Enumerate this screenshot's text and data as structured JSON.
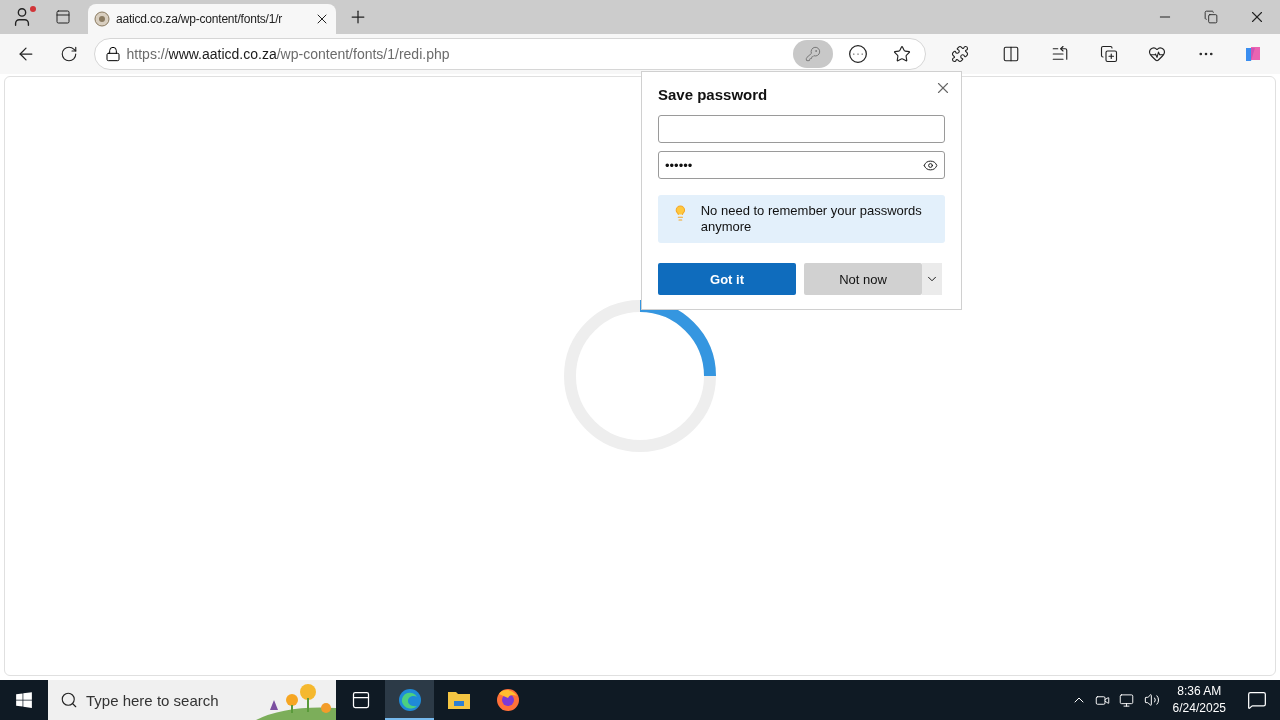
{
  "browser": {
    "tabs": [
      {
        "title": "aaticd.co.za/wp-content/fonts/1/r",
        "selected": true
      }
    ],
    "address": {
      "scheme": "https://",
      "host": "www.aaticd.co.za",
      "path": "/wp-content/fonts/1/redi.php"
    },
    "profile_notification": true
  },
  "save_password_dialog": {
    "title": "Save password",
    "password": {
      "value": "••••••"
    },
    "tip": "No need to remember your passwords anymore",
    "buttons": [
      {
        "label": "Got it",
        "kind": "primary"
      },
      {
        "label": "Not now",
        "kind": "secondary"
      }
    ]
  },
  "taskbar": {
    "search": {
      "placeholder": "Type here to search"
    },
    "apps": [
      {
        "kind": "taskview",
        "active": false
      },
      {
        "kind": "edge",
        "active": true
      },
      {
        "kind": "explorer",
        "active": false
      },
      {
        "kind": "firefox",
        "active": false
      }
    ],
    "time": "8:36 AM",
    "date": "6/24/2025"
  }
}
